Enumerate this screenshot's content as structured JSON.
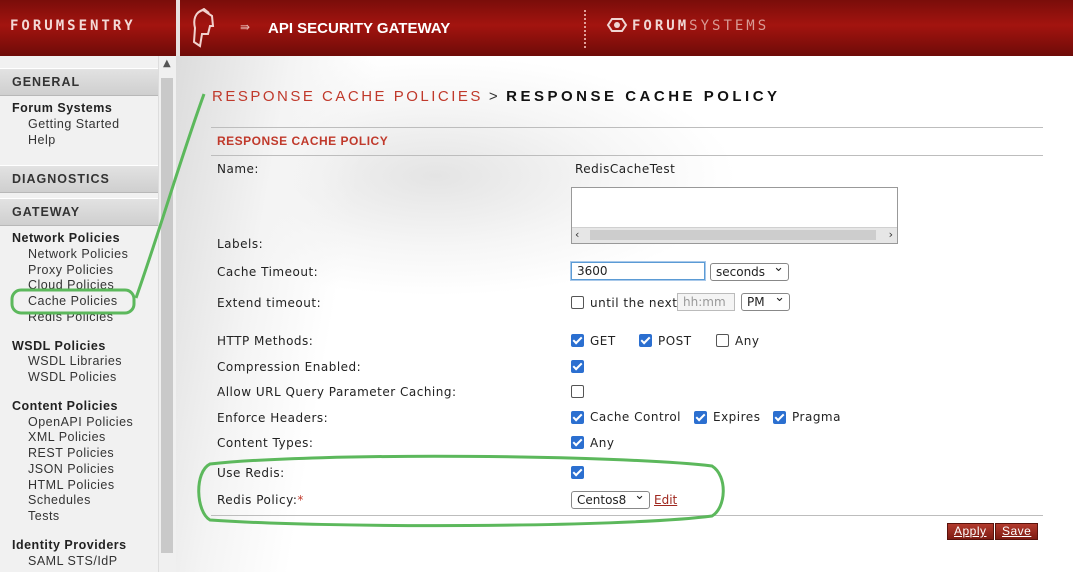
{
  "header": {
    "brand": "FORUMSENTRY",
    "arrow": "⇛",
    "title": "API SECURITY GATEWAY",
    "logo_bold": "FORUM",
    "logo_light": "SYSTEMS"
  },
  "sidebar": {
    "sections": {
      "general": "GENERAL",
      "diagnostics": "DIAGNOSTICS",
      "gateway": "GATEWAY"
    },
    "forum_systems": {
      "title": "Forum Systems",
      "items": [
        "Getting Started",
        "Help"
      ]
    },
    "network_policies": {
      "title": "Network Policies",
      "items": [
        "Network Policies",
        "Proxy Policies",
        "Cloud Policies",
        "Cache Policies",
        "Redis Policies"
      ]
    },
    "wsdl_policies": {
      "title": "WSDL Policies",
      "items": [
        "WSDL Libraries",
        "WSDL Policies"
      ]
    },
    "content_policies": {
      "title": "Content Policies",
      "items": [
        "OpenAPI Policies",
        "XML Policies",
        "REST Policies",
        "JSON Policies",
        "HTML Policies",
        "Schedules",
        "Tests"
      ]
    },
    "identity_providers": {
      "title": "Identity Providers",
      "items": [
        "SAML STS/IdP"
      ]
    }
  },
  "breadcrumb": {
    "parent": "RESPONSE CACHE POLICIES",
    "separator": ">",
    "current": "RESPONSE CACHE POLICY"
  },
  "panel": {
    "title": "RESPONSE CACHE POLICY"
  },
  "form": {
    "name_label": "Name:",
    "name_value": "RedisCacheTest",
    "labels_label": "Labels:",
    "cache_timeout_label": "Cache Timeout:",
    "cache_timeout_value": "3600",
    "cache_timeout_unit": "seconds",
    "extend_timeout_label": "Extend timeout:",
    "until_next_label": "until the next",
    "time_placeholder": "hh:mm",
    "ampm": "PM",
    "http_methods_label": "HTTP Methods:",
    "method_get": "GET",
    "method_post": "POST",
    "method_any": "Any",
    "compression_label": "Compression Enabled:",
    "url_query_label": "Allow URL Query Parameter Caching:",
    "enforce_headers_label": "Enforce Headers:",
    "header_cache_control": "Cache Control",
    "header_expires": "Expires",
    "header_pragma": "Pragma",
    "content_types_label": "Content Types:",
    "content_any": "Any",
    "use_redis_label": "Use Redis:",
    "redis_policy_label": "Redis Policy:",
    "required_mark": "*",
    "redis_policy_value": "Centos8",
    "edit_link": "Edit"
  },
  "checkboxes": {
    "until_next": false,
    "get": true,
    "post": true,
    "any_method": false,
    "compression": true,
    "url_query": false,
    "cache_control": true,
    "expires": true,
    "pragma": true,
    "content_any": true,
    "use_redis": true
  },
  "buttons": {
    "apply": "Apply",
    "save": "Save"
  },
  "colors": {
    "header_red": "#a3140f",
    "accent_red": "#c0392b",
    "checkbox_blue": "#2b6fd0",
    "annotation_green": "#5cb85c"
  }
}
